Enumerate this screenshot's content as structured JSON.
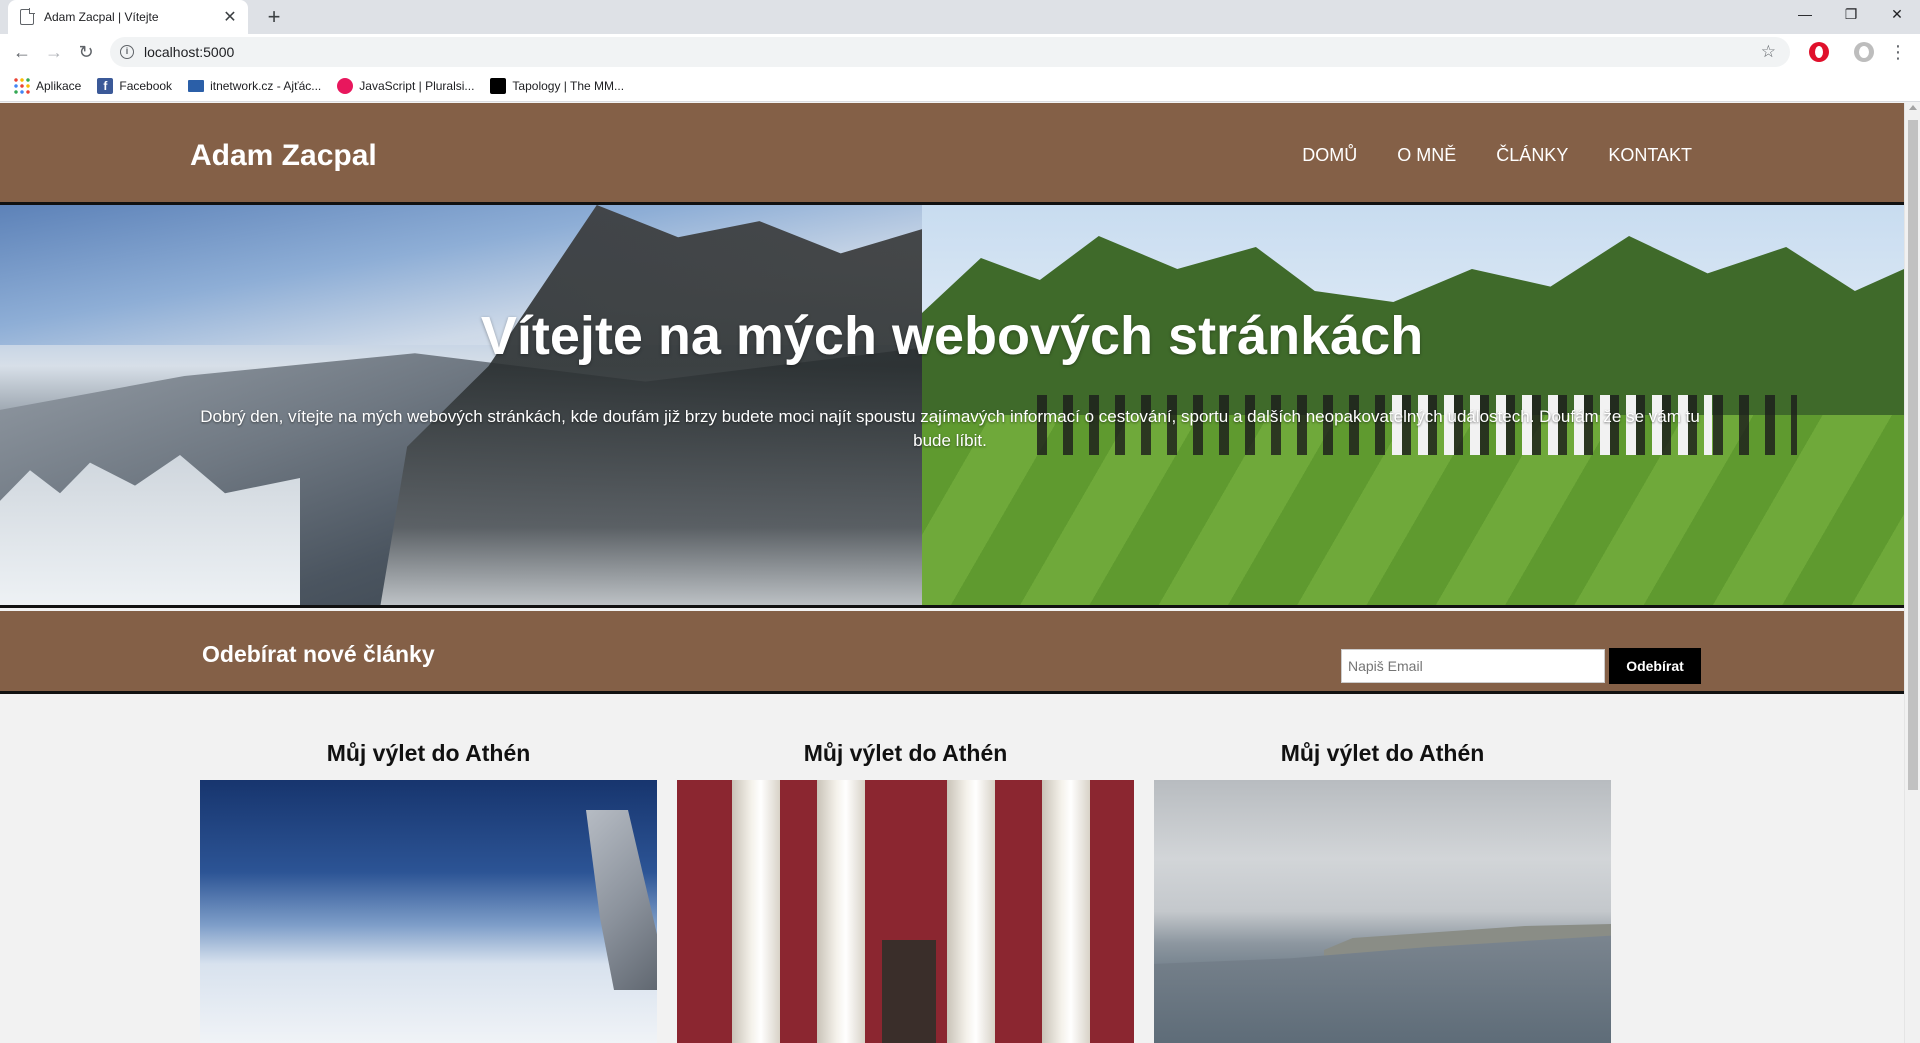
{
  "browser": {
    "tab_title": "Adam Zacpal | Vítejte",
    "tab_close": "✕",
    "new_tab": "+",
    "url": "localhost:5000",
    "window_controls": {
      "minimize": "—",
      "restore": "❐",
      "close": "✕"
    },
    "nav": {
      "back": "←",
      "forward": "→",
      "reload": "↻"
    },
    "star": "☆",
    "menu": "⋮",
    "bookmarks": [
      {
        "label": "Aplikace",
        "icon": "apps-grid-icon"
      },
      {
        "label": "Facebook",
        "icon": "facebook-icon"
      },
      {
        "label": "itnetwork.cz - Ajťác...",
        "icon": "laptop-icon"
      },
      {
        "label": "JavaScript | Pluralsi...",
        "icon": "pluralsight-icon"
      },
      {
        "label": "Tapology | The MM...",
        "icon": "tapology-icon"
      }
    ]
  },
  "site": {
    "logo": "Adam Zacpal",
    "nav": [
      "DOMŮ",
      "O MNĚ",
      "ČLÁNKY",
      "KONTAKT"
    ],
    "hero": {
      "title": "Vítejte na mých webových stránkách",
      "text": "Dobrý den, vítejte na mých webových stránkách, kde doufám již brzy budete moci najít spoustu zajímavých informací o cestování, sportu a dalších neopakovatelných událostech. Doufám že se vám tu bude líbit."
    },
    "subscribe": {
      "title": "Odebírat nové články",
      "placeholder": "Napiš Email",
      "button": "Odebírat"
    },
    "articles": [
      {
        "title": "Můj výlet do Athén"
      },
      {
        "title": "Můj výlet do Athén"
      },
      {
        "title": "Můj výlet do Athén"
      }
    ]
  },
  "colors": {
    "brand_brown": "#846047",
    "button_black": "#000000",
    "page_bg": "#f2f2f2"
  }
}
